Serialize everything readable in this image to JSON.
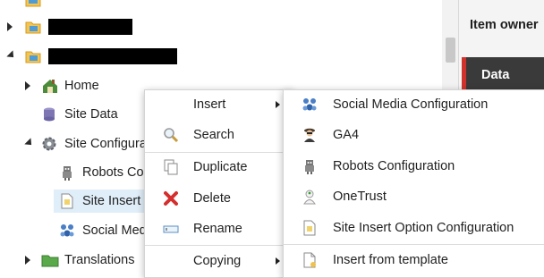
{
  "tree": {
    "nodes": [
      {
        "label": "Home"
      },
      {
        "label": "Site Data"
      },
      {
        "label": "Site Configuration"
      },
      {
        "label": "Robots Configuration"
      },
      {
        "label": "Site Insert Option Configuration"
      },
      {
        "label": "Social Media Configuration"
      },
      {
        "label": "Translations"
      }
    ]
  },
  "right_panel": {
    "header": "Item owner",
    "section": "Data"
  },
  "context_menu": {
    "items": [
      {
        "label": "Insert",
        "icon": "",
        "submenu": true
      },
      {
        "label": "Search",
        "icon": "magnifier-icon"
      },
      {
        "label": "Duplicate",
        "icon": "duplicate-icon"
      },
      {
        "label": "Delete",
        "icon": "delete-x-icon",
        "color": "#d42e2e"
      },
      {
        "label": "Rename",
        "icon": "rename-icon"
      },
      {
        "label": "Copying",
        "icon": "",
        "submenu": true
      }
    ]
  },
  "insert_submenu": {
    "items": [
      {
        "label": "Social Media Configuration",
        "icon": "social-people-icon"
      },
      {
        "label": "GA4",
        "icon": "agent-icon"
      },
      {
        "label": "Robots Configuration",
        "icon": "robot-icon"
      },
      {
        "label": "OneTrust",
        "icon": "onetrust-icon"
      },
      {
        "label": "Site Insert Option Configuration",
        "icon": "insert-option-icon"
      },
      {
        "label": "Insert from template",
        "icon": "template-icon"
      }
    ]
  }
}
